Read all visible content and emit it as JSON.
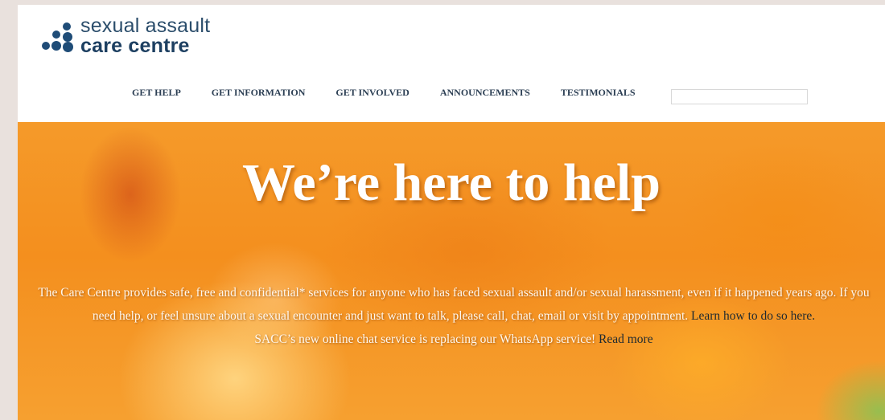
{
  "logo": {
    "line1": "sexual assault",
    "line2": "care centre"
  },
  "nav": {
    "items": [
      "GET HELP",
      "GET INFORMATION",
      "GET INVOLVED",
      "ANNOUNCEMENTS",
      "TESTIMONIALS"
    ]
  },
  "search": {
    "value": ""
  },
  "hero": {
    "title": "We’re here to help",
    "paragraph_text": "The Care Centre provides safe, free and confidential* services for anyone who has faced sexual assault and/or sexual harassment, even if it happened years ago. If you need help, or feel unsure about a sexual encounter and just want to talk, please call, chat, email or visit by appointment.",
    "paragraph_link": "Learn how to do so here.",
    "notice_text": "SACC’s new online chat service is replacing our WhatsApp service!",
    "notice_link": "Read more"
  },
  "colors": {
    "brand_navy": "#1f4c77",
    "hero_orange": "#f48f1e",
    "hero_blue": "#28aaeb"
  }
}
